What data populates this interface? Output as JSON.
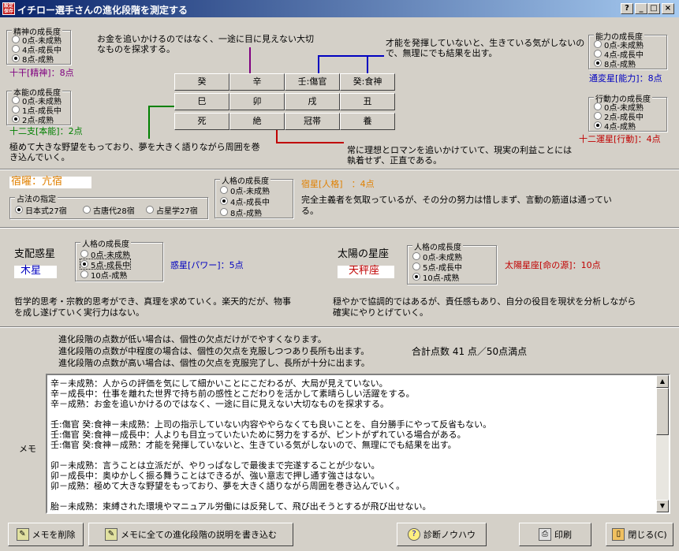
{
  "window": {
    "title": "イチロー選手さんの進化段階を測定する",
    "app_icon": "app-icon",
    "btn_help": "?",
    "btn_min": "_",
    "btn_max": "□",
    "btn_close": "×"
  },
  "top": {
    "seishin": {
      "legend": "精神の成長度",
      "options": [
        "0点-未成熟",
        "4点-成長中",
        "8点-成熟"
      ],
      "selected": 2,
      "result": "十干[精神]：8点"
    },
    "honno": {
      "legend": "本能の成長度",
      "options": [
        "0点-未成熟",
        "1点-成長中",
        "2点-成熟"
      ],
      "selected": 2,
      "result": "十二支[本能]：2点"
    },
    "noryoku": {
      "legend": "能力の成長度",
      "options": [
        "0点-未成熟",
        "4点-成長中",
        "8点-成熟"
      ],
      "selected": 2,
      "result": "通変星[能力]：8点"
    },
    "kodo": {
      "legend": "行動力の成長度",
      "options": [
        "0点-未成熟",
        "2点-成長中",
        "4点-成熟"
      ],
      "selected": 2,
      "result": "十二運星[行動]：4点"
    },
    "ann_top_left": "お金を追いかけるのではなく、一途に目に見えない大切\nなものを探求する。",
    "ann_top_right": "才能を発揮していないと、生きている気がしないの\nで、無理にでも結果を出す。",
    "ann_bottom_left": "極めて大きな野望をもっており、夢を大きく語りながら周囲を巻\nき込んでいく。",
    "ann_bottom_right": "常に理想とロマンを追いかけていて、現実の利益ことには\n執着せず、正直である。",
    "grid": [
      [
        "癸",
        "辛",
        "壬:傷官",
        "癸:食神"
      ],
      [
        "巳",
        "卯",
        "戌",
        "丑"
      ],
      [
        "死",
        "絶",
        "冠帯",
        "養"
      ]
    ]
  },
  "middle": {
    "shukuyo": "宿曜：亢宿",
    "senpo_legend": "占法の指定",
    "senpo_options": [
      "日本式27宿",
      "古唐代28宿",
      "占星学27宿"
    ],
    "senpo_selected": 0,
    "jinkaku_legend": "人格の成長度",
    "jinkaku_options": [
      "0点-未成熟",
      "4点-成長中",
      "8点-成熟"
    ],
    "jinkaku_selected": 1,
    "shukusei_result": "宿星[人格]　：4点",
    "shukusei_desc": "完全主義者を気取っているが、その分の努力は惜しまず、言動の筋道は通ってい\nる。"
  },
  "planet": {
    "label": "支配惑星",
    "name": "木星",
    "legend": "人格の成長度",
    "options": [
      "0点-未成熟",
      "5点-成長中",
      "10点-成熟"
    ],
    "selected": 1,
    "result": "惑星[パワー]：5点",
    "desc": "哲学的思考・宗教的思考ができ、真理を求めていく。楽天的だが、物事\nを成し遂げていく実行力はない。"
  },
  "sun": {
    "label": "太陽の星座",
    "name": "天秤座",
    "legend": "人格の成長度",
    "options": [
      "0点-未成熟",
      "5点-成長中",
      "10点-成熟"
    ],
    "selected": 2,
    "result": "太陽星座[命の源]：10点",
    "desc": "穏やかで協調的ではあるが、責任感もあり、自分の役目を現状を分析しながら\n確実にやりとげていく。"
  },
  "info": {
    "lines": [
      "進化段階の点数が低い場合は、個性の欠点だけがでやすくなります。",
      "進化段階の点数が中程度の場合は、個性の欠点を克服しつつあり長所も出ます。",
      "進化段階の点数が高い場合は、個性の欠点を克服完了し、長所が十分に出ます。"
    ],
    "total": "合計点数 41 点／50点満点"
  },
  "memo": {
    "label": "メモ",
    "lines": [
      "辛－未成熟：人からの評価を気にして細かいことにこだわるが、大局が見えていない。",
      "辛－成長中：仕事を離れた世界で持ち前の感性とこだわりを活かして素晴らしい活躍をする。",
      "辛－成熟：お金を追いかけるのではなく、一途に目に見えない大切なものを探求する。",
      "",
      "壬:傷官 癸:食神－未成熟：上司の指示していない内容ややらなくても良いことを、自分勝手にやって反省もない。",
      "壬:傷官 癸:食神－成長中：人よりも目立っていたいために努力をするが、ピントがずれている場合がある。",
      "壬:傷官 癸:食神－成熟：才能を発揮していないと、生きている気がしないので、無理にでも結果を出す。",
      "",
      "卯－未成熟：言うことは立派だが、やりっぱなしで最後まで完遂することが少ない。",
      "卯－成長中：奥ゆかしく振る舞うことはできるが、強い意志で押し通す強さはない。",
      "卯－成熟：極めて大きな野望をもっており、夢を大きく語りながら周囲を巻き込んでいく。",
      "",
      "胎－未成熟：束縛された環境やマニュアル労働には反発して、飛び出そうとするが飛び出せない。"
    ]
  },
  "buttons": {
    "delete_memo": "メモを削除",
    "write_all": "メモに全ての進化段階の説明を書き込む",
    "knowhow": "診断ノウハウ",
    "print": "印刷",
    "close": "閉じる(C)"
  },
  "colors": {
    "title_start": "#0a246a",
    "title_end": "#a6caf0",
    "face": "#d4d0c8",
    "accent_blue": "#0000c0",
    "accent_red": "#c00000",
    "accent_orange": "#e08000"
  }
}
